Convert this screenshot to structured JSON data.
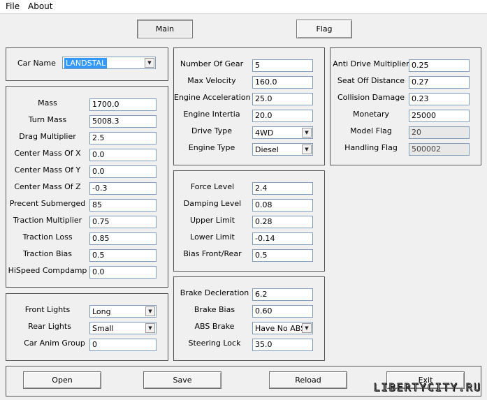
{
  "menu": [
    "File",
    "About"
  ],
  "tabs": {
    "main": "Main",
    "flag": "Flag"
  },
  "car_name": {
    "label": "Car Name",
    "value": "LANDSTAL"
  },
  "physics": [
    {
      "label": "Mass",
      "value": "1700.0"
    },
    {
      "label": "Turn Mass",
      "value": "5008.3"
    },
    {
      "label": "Drag Multiplier",
      "value": "2.5"
    },
    {
      "label": "Center Mass Of X",
      "value": "0.0"
    },
    {
      "label": "Center Mass Of Y",
      "value": "0.0"
    },
    {
      "label": "Center Mass Of Z",
      "value": "-0.3"
    },
    {
      "label": "Precent Submerged",
      "value": "85"
    },
    {
      "label": "Traction Multiplier",
      "value": "0.75"
    },
    {
      "label": "Traction Loss",
      "value": "0.85"
    },
    {
      "label": "Traction Bias",
      "value": "0.5"
    },
    {
      "label": "HiSpeed Compdamp",
      "value": "0.0"
    }
  ],
  "lights": {
    "front_label": "Front Lights",
    "front_value": "Long",
    "rear_label": "Rear Lights",
    "rear_value": "Small",
    "anim_label": "Car Anim Group",
    "anim_value": "0"
  },
  "engine": {
    "gears_label": "Number Of Gear",
    "gears_value": "5",
    "velocity_label": "Max Velocity",
    "velocity_value": "160.0",
    "accel_label": "Engine Acceleration",
    "accel_value": "25.0",
    "inertia_label": "Engine Intertia",
    "inertia_value": "20.0",
    "drive_label": "Drive Type",
    "drive_value": "4WD",
    "type_label": "Engine Type",
    "type_value": "Diesel"
  },
  "suspension": [
    {
      "label": "Force Level",
      "value": "2.4"
    },
    {
      "label": "Damping Level",
      "value": "0.08"
    },
    {
      "label": "Upper Limit",
      "value": "0.28"
    },
    {
      "label": "Lower Limit",
      "value": "-0.14"
    },
    {
      "label": "Bias Front/Rear",
      "value": "0.5"
    }
  ],
  "brakes": {
    "decel_label": "Brake Decleration",
    "decel_value": "6.2",
    "bias_label": "Brake Bias",
    "bias_value": "0.60",
    "abs_label": "ABS Brake",
    "abs_value": "Have No ABS",
    "steer_label": "Steering Lock",
    "steer_value": "35.0"
  },
  "misc": [
    {
      "label": "Anti Drive Multiplier",
      "value": "0.25"
    },
    {
      "label": "Seat Off Distance",
      "value": "0.27"
    },
    {
      "label": "Collision Damage",
      "value": "0.23"
    },
    {
      "label": "Monetary",
      "value": "25000"
    },
    {
      "label": "Model Flag",
      "value": "20"
    },
    {
      "label": "Handling Flag",
      "value": "500002"
    }
  ],
  "buttons": {
    "open": "Open",
    "save": "Save",
    "reload": "Reload",
    "exit": "Exit"
  },
  "watermark": "LIBERTYCITY.RU"
}
